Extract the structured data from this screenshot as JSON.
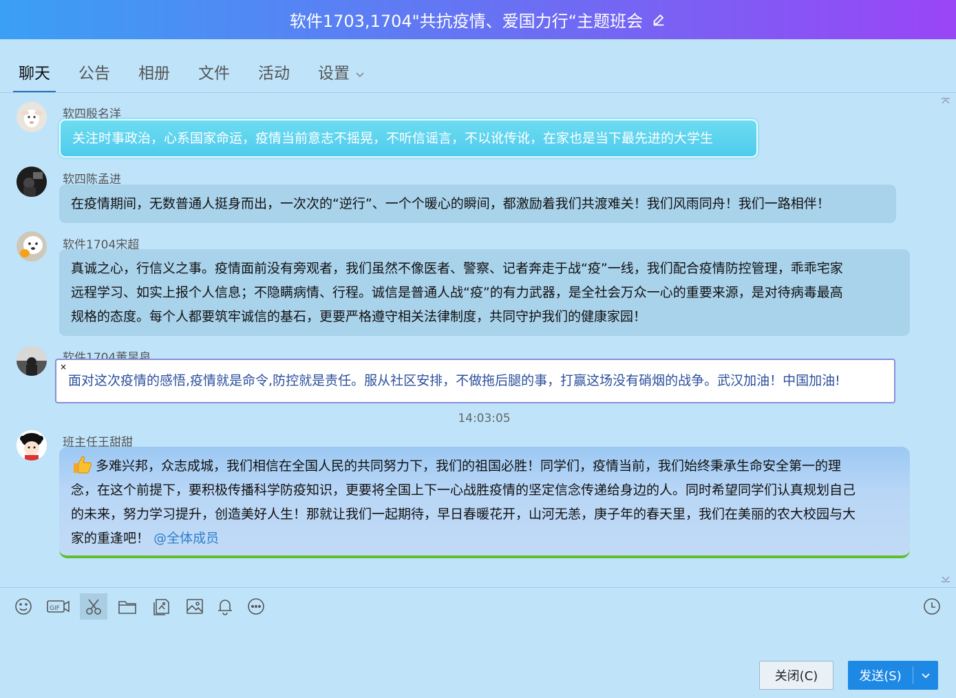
{
  "window": {
    "title": "软件1703,1704\"共抗疫情、爱国力行“主题班会",
    "edit_icon": "pencil-icon"
  },
  "tabs": [
    {
      "label": "聊天",
      "active": true
    },
    {
      "label": "公告"
    },
    {
      "label": "相册"
    },
    {
      "label": "文件"
    },
    {
      "label": "活动"
    },
    {
      "label": "设置"
    }
  ],
  "messages": [
    {
      "sender": "软四殷名洋",
      "text": "关注时事政治，心系国家命运，疫情当前意志不摇晃，不听信谣言，不以讹传讹，在家也是当下最先进的大学生"
    },
    {
      "sender": "软四陈孟进",
      "text": "在疫情期间，无数普通人挺身而出，一次次的“逆行”、一个个暖心的瞬间，都激励着我们共渡难关！我们风雨同舟！我们一路相伴！"
    },
    {
      "sender": "软件1704宋超",
      "lines": [
        "真诚之心，行信义之事。疫情面前没有旁观者，我们虽然不像医者、警察、记者奔走于战“疫”一线，我们配合疫情防控管理，乖乖宅家",
        "远程学习、如实上报个人信息；不隐瞒病情、行程。诚信是普通人战“疫”的有力武器，是全社会万众一心的重要来源，是对待病毒最高",
        "规格的态度。每个人都要筑牢诚信的基石，更要严格遵守相关法律制度，共同守护我们的健康家园！"
      ]
    },
    {
      "sender": "软件1704董昱泉",
      "close_mark": "×",
      "text": "面对这次疫情的感悟,疫情就是命令,防控就是责任。服从社区安排，不做拖后腿的事，打赢这场没有硝烟的战争。武汉加油！中国加油!"
    },
    {
      "sender": "班主任王甜甜",
      "emoji": "thumbs-up-icon",
      "lines": [
        "多难兴邦，众志成城，我们相信在全国人民的共同努力下，我们的祖国必胜！同学们，疫情当前，我们始终秉承生命安全第一的理",
        "念，在这个前提下，要积极传播科学防疫知识，更要将全国上下一心战胜疫情的坚定信念传递给身边的人。同时希望同学们认真规划自己",
        "的未来，努力学习提升，创造美好人生！那就让我们一起期待，早日春暖花开，山河无恙，庚子年的春天里，我们在美丽的农大校园与大",
        "家的重逢吧！"
      ],
      "mention": "@全体成员"
    }
  ],
  "timestamp": "14:03:05",
  "toolbar": {
    "icons": [
      "emoji-icon",
      "gif-icon",
      "scissors-icon",
      "folder-icon",
      "image-gallery-icon",
      "image-icon",
      "bell-icon",
      "more-icon"
    ],
    "history_icon": "clock-icon"
  },
  "buttons": {
    "close_label": "关闭(C)",
    "send_label": "发送(S)"
  },
  "colors": {
    "title_gradient_start": "#3aa0f4",
    "title_gradient_end": "#9a45f6",
    "background": "#bfe4fa",
    "send_button": "#1e88e5"
  }
}
